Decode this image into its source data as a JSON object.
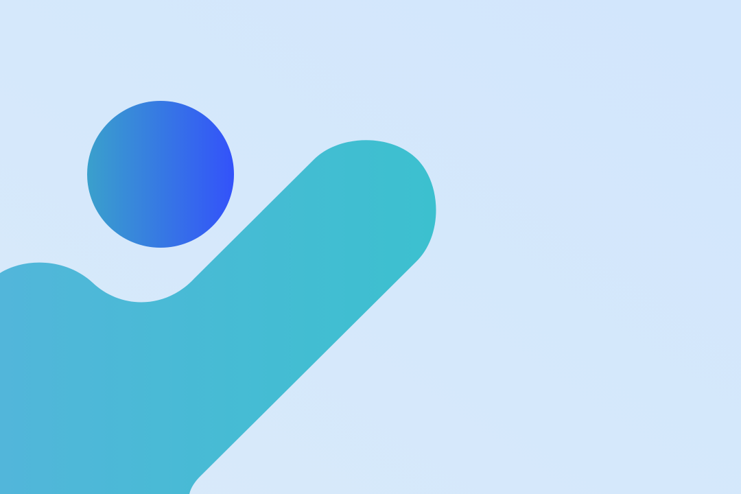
{
  "background": {
    "colors": [
      "#d9eafa",
      "#d2e6fc"
    ]
  },
  "illustration": {
    "description_icon": "person-wave-logo-icon",
    "circle_gradient": [
      "#3aa0cc",
      "#3352fa"
    ],
    "body_gradient": [
      "#52b6da",
      "#3cc0cf"
    ]
  }
}
